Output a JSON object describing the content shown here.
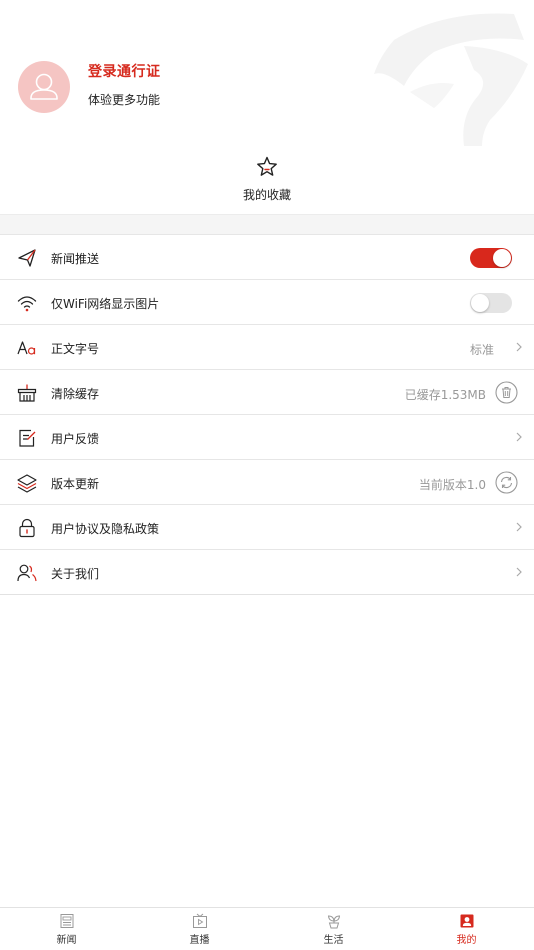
{
  "user": {
    "login_title": "登录通行证",
    "login_subtitle": "体验更多功能"
  },
  "favorites": {
    "label": "我的收藏",
    "icon": "star-icon"
  },
  "settings": [
    {
      "icon": "send-icon",
      "label": "新闻推送",
      "control": "toggle",
      "toggle_on": true
    },
    {
      "icon": "wifi-icon",
      "label": "仅WiFi网络显示图片",
      "control": "toggle",
      "toggle_on": false
    },
    {
      "icon": "font-size-icon",
      "label": "正文字号",
      "value": "标准"
    },
    {
      "icon": "basket-icon",
      "label": "清除缓存",
      "value": "已缓存1.53MB"
    },
    {
      "icon": "feedback-icon",
      "label": "用户反馈"
    },
    {
      "icon": "layers-icon",
      "label": "版本更新",
      "value": "当前版本1.0"
    },
    {
      "icon": "lock-icon",
      "label": "用户协议及隐私政策"
    },
    {
      "icon": "users-icon",
      "label": "关于我们"
    }
  ],
  "tabs": [
    {
      "label": "新闻",
      "icon": "newspaper-icon",
      "active": false
    },
    {
      "label": "直播",
      "icon": "tv-icon",
      "active": false
    },
    {
      "label": "生活",
      "icon": "sprout-icon",
      "active": false
    },
    {
      "label": "我的",
      "icon": "profile-icon",
      "active": true
    }
  ],
  "colors": {
    "accent": "#d62a1e",
    "avatar_bg": "#f5c5c3",
    "toggle_off": "#e4e4e4",
    "section_gap": "#f5f5f5"
  }
}
